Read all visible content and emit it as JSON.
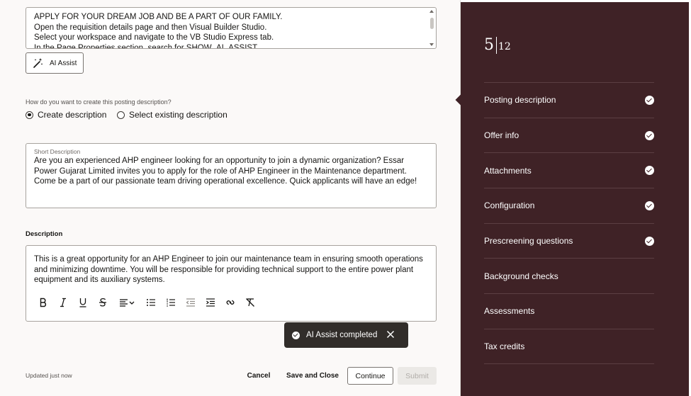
{
  "editor": {
    "ai_text_lines": [
      "APPLY FOR YOUR DREAM JOB AND BE A PART OF OUR FAMILY.",
      "Open the requisition details page and then Visual Builder Studio.",
      "Select your workspace and navigate to the VB Studio Express tab.",
      "In the Page Properties section, search for SHOW_AI_ASSIST"
    ],
    "ai_assist_label": "AI Assist",
    "create_question": "How do you want to create this posting description?",
    "option_create": "Create description",
    "option_existing": "Select existing description",
    "short_desc_label": "Short Description",
    "short_desc_text": "Are you an experienced AHP engineer looking for an opportunity to join a dynamic organization? Essar Power Gujarat Limited invites you to apply for the role of AHP Engineer in the Maintenance department. Come be a part of our passionate team driving operational excellence. Quick applicants will have an edge!",
    "description_label": "Description",
    "description_text": "This is a great opportunity for an AHP Engineer to join our maintenance team in ensuring smooth operations and minimizing downtime. You will be responsible for providing technical support to the entire power plant equipment and its auxiliary systems."
  },
  "footer": {
    "status": "Updated just now",
    "cancel": "Cancel",
    "save_close": "Save and Close",
    "continue": "Continue",
    "submit": "Submit"
  },
  "toast": {
    "message": "AI Assist completed"
  },
  "steps": {
    "current": "5",
    "total": "12",
    "items": [
      {
        "label": "Posting description",
        "done": true
      },
      {
        "label": "Offer info",
        "done": true
      },
      {
        "label": "Attachments",
        "done": true
      },
      {
        "label": "Configuration",
        "done": true
      },
      {
        "label": "Prescreening questions",
        "done": true
      },
      {
        "label": "Background checks",
        "done": false
      },
      {
        "label": "Assessments",
        "done": false
      },
      {
        "label": "Tax credits",
        "done": false
      }
    ]
  },
  "colors": {
    "panel": "#3f2226",
    "toast": "#312d2a",
    "page": "#fbf9f8"
  }
}
